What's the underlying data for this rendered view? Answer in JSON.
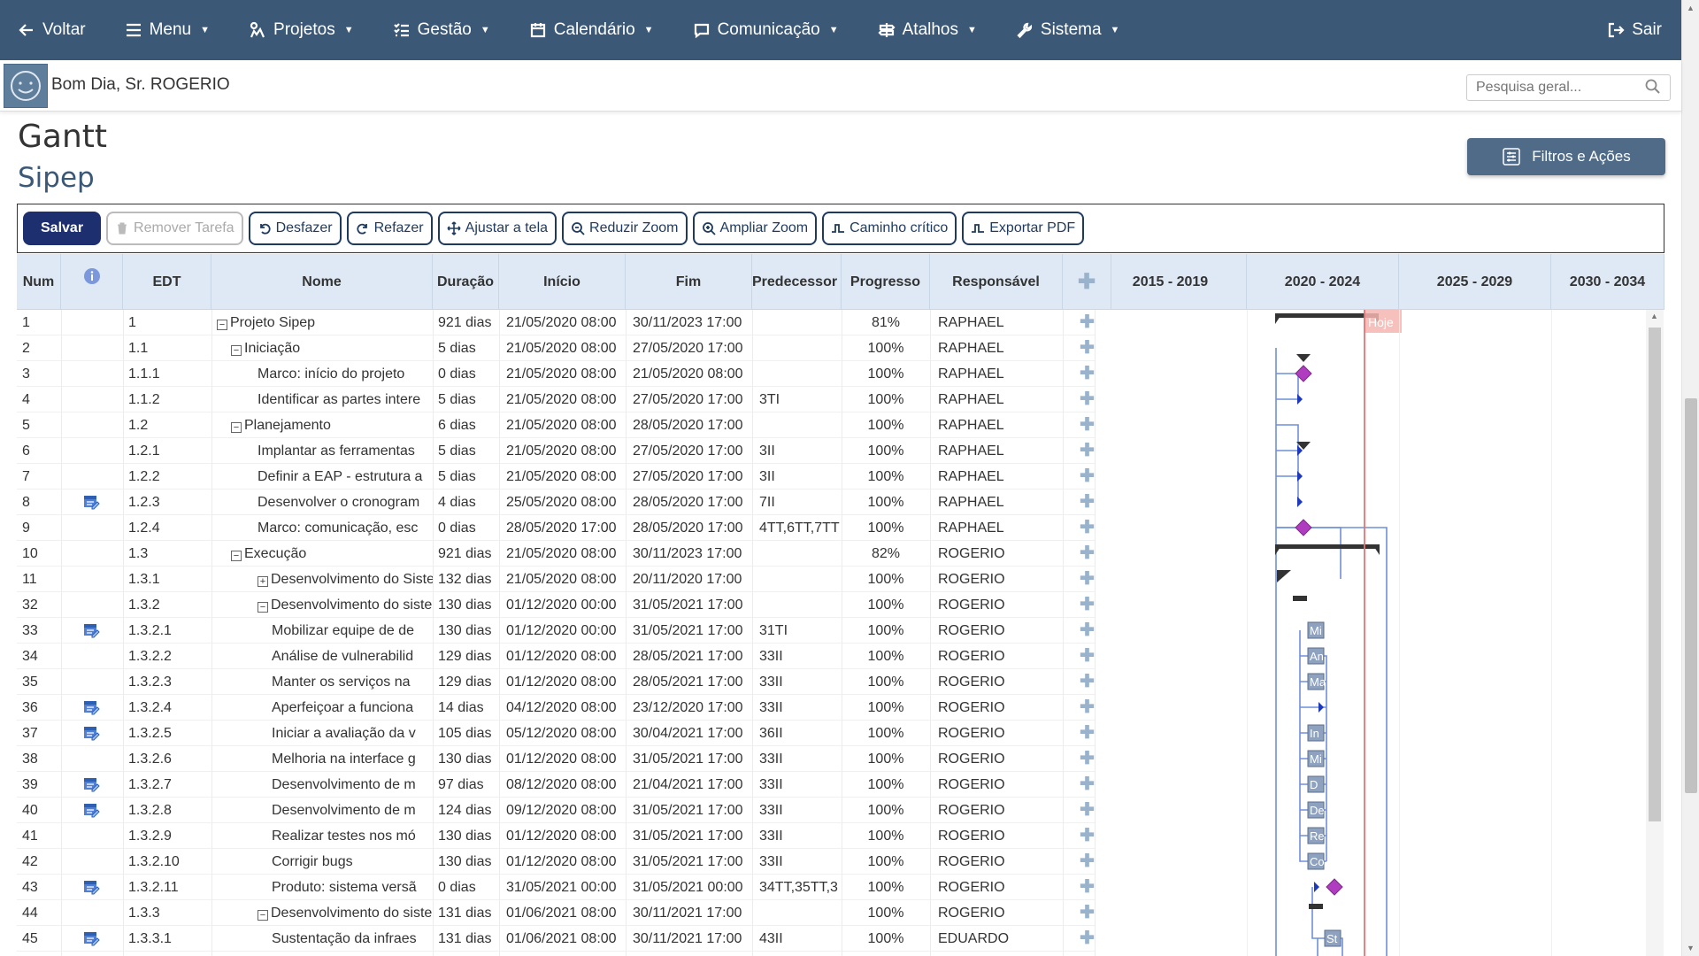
{
  "nav": {
    "back": "Voltar",
    "menu": "Menu",
    "projects": "Projetos",
    "management": "Gestão",
    "calendar": "Calendário",
    "communication": "Comunicação",
    "shortcuts": "Atalhos",
    "system": "Sistema",
    "exit": "Sair"
  },
  "greeting": "Bom Dia, Sr. ROGERIO",
  "search": {
    "placeholder": "Pesquisa geral..."
  },
  "page": {
    "title": "Gantt",
    "subtitle": "Sipep"
  },
  "filters_label": "Filtros e Ações",
  "toolbar": {
    "save": "Salvar",
    "remove": "Remover Tarefa",
    "undo": "Desfazer",
    "redo": "Refazer",
    "fit": "Ajustar a tela",
    "zoom_out": "Reduzir Zoom",
    "zoom_in": "Ampliar Zoom",
    "critical": "Caminho crítico",
    "export": "Exportar PDF"
  },
  "columns": {
    "num": "Num",
    "edt": "EDT",
    "name": "Nome",
    "duration": "Duração",
    "start": "Início",
    "end": "Fim",
    "pred": "Predecessor",
    "progress": "Progresso",
    "owner": "Responsável"
  },
  "timeline": [
    "2015 - 2019",
    "2020 - 2024",
    "2025 - 2029",
    "2030 - 2034"
  ],
  "today_label": "Hoje",
  "rows": [
    {
      "num": "1",
      "edt": "1",
      "name": "Projeto Sipep",
      "level": 0,
      "toggle": "minus",
      "dur": "921 dias",
      "start": "21/05/2020 08:00",
      "end": "30/11/2023 17:00",
      "pred": "",
      "prog": "81%",
      "owner": "RAPHAEL",
      "icon": false
    },
    {
      "num": "2",
      "edt": "1.1",
      "name": "Iniciação",
      "level": 1,
      "toggle": "minus",
      "dur": "5 dias",
      "start": "21/05/2020 08:00",
      "end": "27/05/2020 17:00",
      "pred": "",
      "prog": "100%",
      "owner": "RAPHAEL",
      "icon": false
    },
    {
      "num": "3",
      "edt": "1.1.1",
      "name": "Marco: início do projeto",
      "level": 2,
      "toggle": "",
      "dur": "0 dias",
      "start": "21/05/2020 08:00",
      "end": "21/05/2020 08:00",
      "pred": "",
      "prog": "100%",
      "owner": "RAPHAEL",
      "icon": false
    },
    {
      "num": "4",
      "edt": "1.1.2",
      "name": "Identificar as partes intere",
      "level": 2,
      "toggle": "",
      "dur": "5 dias",
      "start": "21/05/2020 08:00",
      "end": "27/05/2020 17:00",
      "pred": "3TI",
      "prog": "100%",
      "owner": "RAPHAEL",
      "icon": false
    },
    {
      "num": "5",
      "edt": "1.2",
      "name": "Planejamento",
      "level": 1,
      "toggle": "minus",
      "dur": "6 dias",
      "start": "21/05/2020 08:00",
      "end": "28/05/2020 17:00",
      "pred": "",
      "prog": "100%",
      "owner": "RAPHAEL",
      "icon": false
    },
    {
      "num": "6",
      "edt": "1.2.1",
      "name": "Implantar as ferramentas",
      "level": 2,
      "toggle": "",
      "dur": "5 dias",
      "start": "21/05/2020 08:00",
      "end": "27/05/2020 17:00",
      "pred": "3II",
      "prog": "100%",
      "owner": "RAPHAEL",
      "icon": false
    },
    {
      "num": "7",
      "edt": "1.2.2",
      "name": "Definir a EAP - estrutura a",
      "level": 2,
      "toggle": "",
      "dur": "5 dias",
      "start": "21/05/2020 08:00",
      "end": "27/05/2020 17:00",
      "pred": "3II",
      "prog": "100%",
      "owner": "RAPHAEL",
      "icon": false
    },
    {
      "num": "8",
      "edt": "1.2.3",
      "name": "Desenvolver o cronogram",
      "level": 2,
      "toggle": "",
      "dur": "4 dias",
      "start": "25/05/2020 08:00",
      "end": "28/05/2020 17:00",
      "pred": "7II",
      "prog": "100%",
      "owner": "RAPHAEL",
      "icon": true
    },
    {
      "num": "9",
      "edt": "1.2.4",
      "name": "Marco: comunicação, esc",
      "level": 2,
      "toggle": "",
      "dur": "0 dias",
      "start": "28/05/2020 17:00",
      "end": "28/05/2020 17:00",
      "pred": "4TT,6TT,7TT",
      "prog": "100%",
      "owner": "RAPHAEL",
      "icon": false
    },
    {
      "num": "10",
      "edt": "1.3",
      "name": "Execução",
      "level": 1,
      "toggle": "minus",
      "dur": "921 dias",
      "start": "21/05/2020 08:00",
      "end": "30/11/2023 17:00",
      "pred": "",
      "prog": "82%",
      "owner": "ROGERIO",
      "icon": false
    },
    {
      "num": "11",
      "edt": "1.3.1",
      "name": "Desenvolvimento do Siste",
      "level": 2,
      "toggle": "plus",
      "dur": "132 dias",
      "start": "21/05/2020 08:00",
      "end": "20/11/2020 17:00",
      "pred": "",
      "prog": "100%",
      "owner": "ROGERIO",
      "icon": false
    },
    {
      "num": "32",
      "edt": "1.3.2",
      "name": "Desenvolvimento do siste",
      "level": 2,
      "toggle": "minus",
      "dur": "130 dias",
      "start": "01/12/2020 00:00",
      "end": "31/05/2021 17:00",
      "pred": "",
      "prog": "100%",
      "owner": "ROGERIO",
      "icon": false
    },
    {
      "num": "33",
      "edt": "1.3.2.1",
      "name": "Mobilizar equipe de de",
      "level": 3,
      "toggle": "",
      "dur": "130 dias",
      "start": "01/12/2020 00:00",
      "end": "31/05/2021 17:00",
      "pred": "31TI",
      "prog": "100%",
      "owner": "ROGERIO",
      "icon": true
    },
    {
      "num": "34",
      "edt": "1.3.2.2",
      "name": "Análise de vulnerabilid",
      "level": 3,
      "toggle": "",
      "dur": "129 dias",
      "start": "01/12/2020 08:00",
      "end": "28/05/2021 17:00",
      "pred": "33II",
      "prog": "100%",
      "owner": "ROGERIO",
      "icon": false
    },
    {
      "num": "35",
      "edt": "1.3.2.3",
      "name": "Manter os serviços na",
      "level": 3,
      "toggle": "",
      "dur": "129 dias",
      "start": "01/12/2020 08:00",
      "end": "28/05/2021 17:00",
      "pred": "33II",
      "prog": "100%",
      "owner": "ROGERIO",
      "icon": false
    },
    {
      "num": "36",
      "edt": "1.3.2.4",
      "name": "Aperfeiçoar a funciona",
      "level": 3,
      "toggle": "",
      "dur": "14 dias",
      "start": "04/12/2020 08:00",
      "end": "23/12/2020 17:00",
      "pred": "33II",
      "prog": "100%",
      "owner": "ROGERIO",
      "icon": true
    },
    {
      "num": "37",
      "edt": "1.3.2.5",
      "name": "Iniciar a avaliação da v",
      "level": 3,
      "toggle": "",
      "dur": "105 dias",
      "start": "05/12/2020 08:00",
      "end": "30/04/2021 17:00",
      "pred": "36II",
      "prog": "100%",
      "owner": "ROGERIO",
      "icon": true
    },
    {
      "num": "38",
      "edt": "1.3.2.6",
      "name": "Melhoria na interface g",
      "level": 3,
      "toggle": "",
      "dur": "130 dias",
      "start": "01/12/2020 08:00",
      "end": "31/05/2021 17:00",
      "pred": "33II",
      "prog": "100%",
      "owner": "ROGERIO",
      "icon": false
    },
    {
      "num": "39",
      "edt": "1.3.2.7",
      "name": "Desenvolvimento de m",
      "level": 3,
      "toggle": "",
      "dur": "97 dias",
      "start": "08/12/2020 08:00",
      "end": "21/04/2021 17:00",
      "pred": "33II",
      "prog": "100%",
      "owner": "ROGERIO",
      "icon": true
    },
    {
      "num": "40",
      "edt": "1.3.2.8",
      "name": "Desenvolvimento de m",
      "level": 3,
      "toggle": "",
      "dur": "124 dias",
      "start": "09/12/2020 08:00",
      "end": "31/05/2021 17:00",
      "pred": "33II",
      "prog": "100%",
      "owner": "ROGERIO",
      "icon": true
    },
    {
      "num": "41",
      "edt": "1.3.2.9",
      "name": "Realizar testes nos mó",
      "level": 3,
      "toggle": "",
      "dur": "130 dias",
      "start": "01/12/2020 08:00",
      "end": "31/05/2021 17:00",
      "pred": "33II",
      "prog": "100%",
      "owner": "ROGERIO",
      "icon": false
    },
    {
      "num": "42",
      "edt": "1.3.2.10",
      "name": "Corrigir bugs",
      "level": 3,
      "toggle": "",
      "dur": "130 dias",
      "start": "01/12/2020 08:00",
      "end": "31/05/2021 17:00",
      "pred": "33II",
      "prog": "100%",
      "owner": "ROGERIO",
      "icon": false
    },
    {
      "num": "43",
      "edt": "1.3.2.11",
      "name": "Produto: sistema versã",
      "level": 3,
      "toggle": "",
      "dur": "0 dias",
      "start": "31/05/2021 00:00",
      "end": "31/05/2021 00:00",
      "pred": "34TT,35TT,3",
      "prog": "100%",
      "owner": "ROGERIO",
      "icon": true
    },
    {
      "num": "44",
      "edt": "1.3.3",
      "name": "Desenvolvimento do siste",
      "level": 2,
      "toggle": "minus",
      "dur": "131 dias",
      "start": "01/06/2021 08:00",
      "end": "30/11/2021 17:00",
      "pred": "",
      "prog": "100%",
      "owner": "ROGERIO",
      "icon": false
    },
    {
      "num": "45",
      "edt": "1.3.3.1",
      "name": "Sustentação da infraes",
      "level": 3,
      "toggle": "",
      "dur": "131 dias",
      "start": "01/06/2021 08:00",
      "end": "30/11/2021 17:00",
      "pred": "43II",
      "prog": "100%",
      "owner": "EDUARDO",
      "icon": true
    }
  ],
  "bar_labels": [
    "Mi",
    "An",
    "Ma",
    "In",
    "Mi",
    "D",
    "De",
    "Re",
    "Co",
    "St"
  ],
  "colors": {
    "nav": "#3b5877",
    "accent": "#1e2f70",
    "header": "#dfe9f5",
    "milestone": "#b03dc0",
    "today": "#e57373",
    "link": "#6f8fd8"
  }
}
